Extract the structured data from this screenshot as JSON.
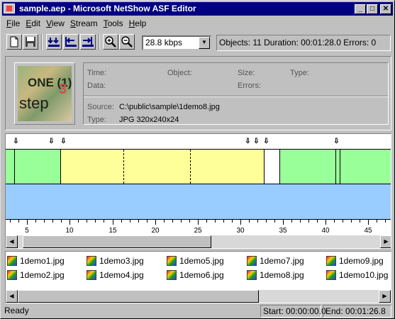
{
  "window": {
    "title": "sample.aep - Microsoft NetShow ASF Editor"
  },
  "menu": [
    "File",
    "Edit",
    "View",
    "Stream",
    "Tools",
    "Help"
  ],
  "toolbar": {
    "bitrate": "28.8 kbps",
    "stats": "Objects: 11  Duration: 00:01:28.0  Errors: 0"
  },
  "info": {
    "time_label": "Time:",
    "object_label": "Object:",
    "size_label": "Size:",
    "type_label": "Type:",
    "data_label": "Data:",
    "errors_label": "Errors:",
    "source_label": "Source:",
    "source_value": "C:\\public\\sample\\1demo8.jpg",
    "type2_label": "Type:",
    "type2_value": "JPG 320x240x24",
    "thumb_text1": "ONE (1)",
    "thumb_text2": "step",
    "thumb_text3": "3"
  },
  "ruler": {
    "labels": [
      "5",
      "10",
      "15",
      "20",
      "25",
      "30",
      "35",
      "40",
      "45"
    ]
  },
  "files": [
    "1demo1.jpg",
    "1demo3.jpg",
    "1demo5.jpg",
    "1demo7.jpg",
    "1demo9.jpg",
    "1demo2.jpg",
    "1demo4.jpg",
    "1demo6.jpg",
    "1demo8.jpg",
    "1demo10.jpg"
  ],
  "status": {
    "text": "Ready",
    "start": "Start: 00:00:00.0",
    "end": "End: 00:01:26.8"
  },
  "colors": {
    "green": "#99ff99",
    "yellow": "#ffff99",
    "blue": "#99ccff",
    "title": "#000080"
  }
}
